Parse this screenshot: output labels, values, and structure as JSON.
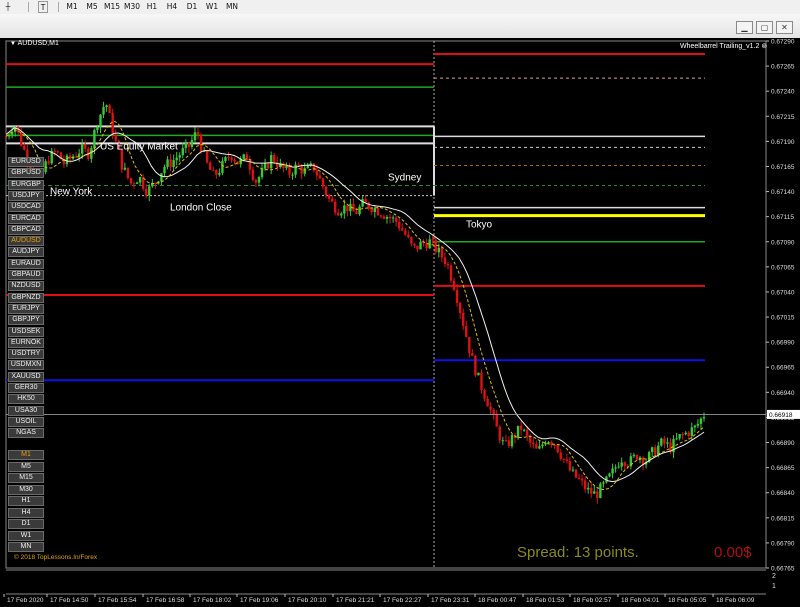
{
  "toolbar": {
    "text_tool": "T",
    "timeframes": [
      "M1",
      "M5",
      "M15",
      "M30",
      "H1",
      "H4",
      "D1",
      "W1",
      "MN"
    ]
  },
  "window": {
    "minimize_icon": "minimize-icon",
    "maximize_icon": "maximize-icon",
    "close_icon": "close-icon"
  },
  "chart": {
    "symbol_label": "AUDUSD,M1",
    "indicator_label": "Wheelbarrel Trailing_v1.2",
    "copyright": "© 2018 TopLessons.In/Forex",
    "spread_text": "Spread: 13 points.",
    "profit_text": "0.00$",
    "session_labels": [
      "New York",
      "US Equity Market",
      "London Close",
      "Sydney",
      "Tokyo"
    ],
    "current_price": "0.66918",
    "subwindow_ticks": [
      "2",
      "1"
    ],
    "colors": {
      "bull": "#33cc33",
      "bear": "#dd1111",
      "level_red": "#e01010",
      "level_green": "#22aa22",
      "level_blue": "#1010e8",
      "level_yellow": "#ffff00",
      "level_white": "#dddddd",
      "spread": "#8a8a1e",
      "profit": "#b01010",
      "active_symbol": "#e8a200"
    }
  },
  "symbols": [
    "EURUSD",
    "GBPUSD",
    "EURGBP",
    "USDJPY",
    "USDCAD",
    "EURCAD",
    "GBPCAD",
    "AUDUSD",
    "AUDJPY",
    "EURAUD",
    "GBPAUD",
    "NZDUSD",
    "GBPNZD",
    "EURJPY",
    "GBPJPY",
    "USDSEK",
    "EURNOK",
    "USDTRY",
    "USDMXN",
    "XAUUSD",
    "GER30",
    "HK50",
    "USA30",
    "USOIL",
    "NGAS"
  ],
  "active_symbol": "AUDUSD",
  "chart_timeframes": [
    "M1",
    "M5",
    "M15",
    "M30",
    "H1",
    "H4",
    "D1",
    "W1",
    "MN"
  ],
  "active_timeframe": "M1",
  "chart_data": {
    "type": "candlestick",
    "ylim": [
      0.66765,
      0.6729
    ],
    "y_ticks": [
      0.6729,
      0.67265,
      0.6724,
      0.67215,
      0.6719,
      0.67165,
      0.6714,
      0.67115,
      0.6709,
      0.67065,
      0.6704,
      0.67015,
      0.6699,
      0.66965,
      0.6694,
      0.66915,
      0.6689,
      0.66865,
      0.6684,
      0.66815,
      0.6679,
      0.66765
    ],
    "x_ticks": [
      "17 Feb 2020",
      "17 Feb 14:50",
      "17 Feb 15:54",
      "17 Feb 16:58",
      "17 Feb 18:02",
      "17 Feb 19:06",
      "17 Feb 20:10",
      "17 Feb 21:21",
      "17 Feb 22:27",
      "17 Feb 23:31",
      "18 Feb 00:47",
      "18 Feb 01:53",
      "18 Feb 02:57",
      "18 Feb 04:01",
      "18 Feb 05:05",
      "18 Feb 06:09"
    ],
    "price_path": [
      [
        0,
        0.67195
      ],
      [
        2,
        0.67208
      ],
      [
        4,
        0.67185
      ],
      [
        6,
        0.67165
      ],
      [
        8,
        0.6715
      ],
      [
        10,
        0.67172
      ],
      [
        12,
        0.6718
      ],
      [
        14,
        0.67168
      ],
      [
        16,
        0.67175
      ],
      [
        18,
        0.67182
      ],
      [
        20,
        0.67178
      ],
      [
        22,
        0.6721
      ],
      [
        24,
        0.6723
      ],
      [
        26,
        0.67195
      ],
      [
        28,
        0.67165
      ],
      [
        30,
        0.67148
      ],
      [
        32,
        0.67155
      ],
      [
        34,
        0.6714
      ],
      [
        36,
        0.6715
      ],
      [
        38,
        0.67165
      ],
      [
        40,
        0.6717
      ],
      [
        42,
        0.67178
      ],
      [
        44,
        0.67185
      ],
      [
        46,
        0.672
      ],
      [
        48,
        0.6717
      ],
      [
        50,
        0.67155
      ],
      [
        52,
        0.67165
      ],
      [
        54,
        0.67178
      ],
      [
        56,
        0.67168
      ],
      [
        58,
        0.67175
      ],
      [
        60,
        0.6715
      ],
      [
        62,
        0.6716
      ],
      [
        64,
        0.67175
      ],
      [
        66,
        0.67165
      ],
      [
        68,
        0.67158
      ],
      [
        70,
        0.67165
      ],
      [
        72,
        0.6716
      ],
      [
        74,
        0.67165
      ],
      [
        76,
        0.67148
      ],
      [
        78,
        0.6713
      ],
      [
        80,
        0.67122
      ],
      [
        82,
        0.67125
      ],
      [
        84,
        0.67118
      ],
      [
        86,
        0.67128
      ],
      [
        88,
        0.67125
      ],
      [
        90,
        0.6712
      ],
      [
        92,
        0.67115
      ],
      [
        94,
        0.6711
      ],
      [
        96,
        0.67098
      ],
      [
        98,
        0.67082
      ],
      [
        100,
        0.67088
      ],
      [
        102,
        0.6709
      ],
      [
        104,
        0.6708
      ],
      [
        106,
        0.6707
      ],
      [
        108,
        0.67045
      ],
      [
        110,
        0.6701
      ],
      [
        112,
        0.66975
      ],
      [
        114,
        0.6695
      ],
      [
        116,
        0.6693
      ],
      [
        118,
        0.66905
      ],
      [
        120,
        0.66885
      ],
      [
        122,
        0.66895
      ],
      [
        124,
        0.66905
      ],
      [
        126,
        0.6689
      ],
      [
        128,
        0.6688
      ],
      [
        130,
        0.66895
      ],
      [
        132,
        0.6689
      ],
      [
        134,
        0.66875
      ],
      [
        136,
        0.6686
      ],
      [
        138,
        0.66852
      ],
      [
        140,
        0.66842
      ],
      [
        142,
        0.66838
      ],
      [
        144,
        0.66848
      ],
      [
        146,
        0.6686
      ],
      [
        148,
        0.66875
      ],
      [
        150,
        0.6687
      ],
      [
        152,
        0.66878
      ],
      [
        154,
        0.66872
      ],
      [
        156,
        0.66882
      ],
      [
        158,
        0.6689
      ],
      [
        160,
        0.66885
      ],
      [
        162,
        0.66895
      ],
      [
        164,
        0.669
      ],
      [
        166,
        0.66905
      ],
      [
        168,
        0.66918
      ]
    ],
    "levels_before": [
      {
        "price": 0.67267,
        "color": "level_red",
        "width": 2
      },
      {
        "price": 0.67244,
        "color": "level_green",
        "width": 1.5
      },
      {
        "price": 0.67205,
        "color": "level_white",
        "width": 2
      },
      {
        "price": 0.67196,
        "color": "level_green",
        "width": 1.5
      },
      {
        "price": 0.67188,
        "color": "level_white",
        "width": 2
      },
      {
        "price": 0.67037,
        "color": "level_red",
        "width": 2
      },
      {
        "price": 0.66952,
        "color": "level_blue",
        "width": 2
      }
    ],
    "levels_after": [
      {
        "price": 0.67277,
        "color": "level_red",
        "width": 2
      },
      {
        "price": 0.67195,
        "color": "level_white",
        "width": 1.5
      },
      {
        "price": 0.67124,
        "color": "level_white",
        "width": 1.5
      },
      {
        "price": 0.67116,
        "color": "level_yellow",
        "width": 3
      },
      {
        "price": 0.6709,
        "color": "level_green",
        "width": 1.5
      },
      {
        "price": 0.67046,
        "color": "level_red",
        "width": 2
      },
      {
        "price": 0.66972,
        "color": "level_blue",
        "width": 2
      }
    ]
  }
}
